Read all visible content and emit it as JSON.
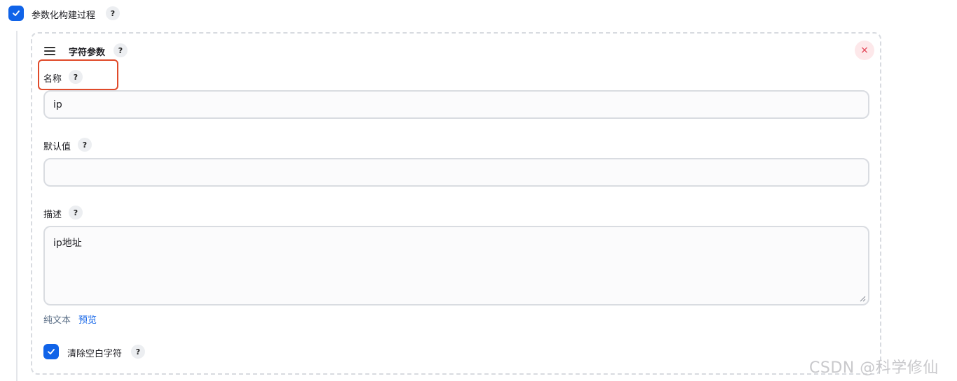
{
  "parameterized": {
    "checked": true,
    "label": "参数化构建过程",
    "help": "?"
  },
  "param_card": {
    "title": "字符参数",
    "help": "?",
    "close_glyph": "×",
    "name": {
      "label": "名称",
      "help": "?",
      "value": "ip"
    },
    "default": {
      "label": "默认值",
      "help": "?",
      "value": ""
    },
    "description": {
      "label": "描述",
      "help": "?",
      "value": "ip地址",
      "format_plain": "纯文本",
      "format_preview": "预览"
    },
    "trim": {
      "checked": true,
      "label": "清除空白字符",
      "help": "?"
    }
  },
  "watermark": "CSDN @科学修仙",
  "colors": {
    "accent": "#1063e8",
    "close": "#e23b4e",
    "highlight_box": "#e04a2a"
  }
}
